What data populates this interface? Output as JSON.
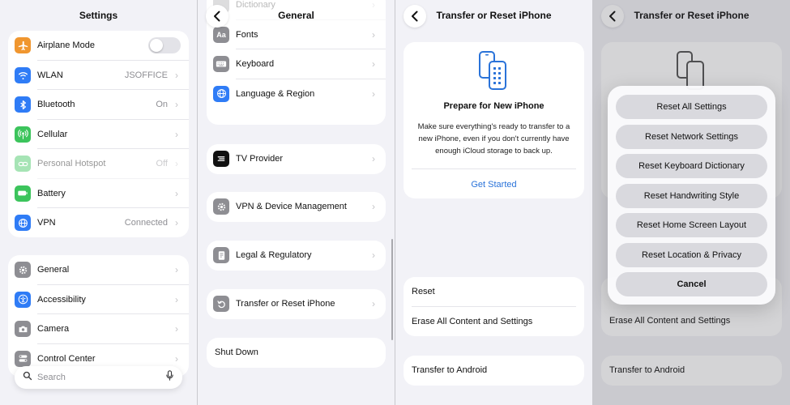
{
  "panel1": {
    "title": "Settings",
    "group1": [
      {
        "name": "airplane",
        "label": "Airplane Mode",
        "value": "",
        "icon": "airplane-icon",
        "color": "#f0962f"
      },
      {
        "name": "wlan",
        "label": "WLAN",
        "value": "JSOFFICE",
        "icon": "wifi-icon",
        "color": "#2f7cf6"
      },
      {
        "name": "bluetooth",
        "label": "Bluetooth",
        "value": "On",
        "icon": "bluetooth-icon",
        "color": "#2f7cf6"
      },
      {
        "name": "cellular",
        "label": "Cellular",
        "value": "",
        "icon": "antenna-icon",
        "color": "#3cc45c"
      },
      {
        "name": "hotspot",
        "label": "Personal Hotspot",
        "value": "Off",
        "icon": "link-icon",
        "color": "#3cc45c"
      },
      {
        "name": "battery",
        "label": "Battery",
        "value": "",
        "icon": "battery-icon",
        "color": "#3cc45c"
      },
      {
        "name": "vpn",
        "label": "VPN",
        "value": "Connected",
        "icon": "globe-icon",
        "color": "#2f7cf6"
      }
    ],
    "group2": [
      {
        "name": "general",
        "label": "General",
        "value": "",
        "icon": "gear-icon",
        "color": "#8e8e93"
      },
      {
        "name": "accessibility",
        "label": "Accessibility",
        "value": "",
        "icon": "accessibility-icon",
        "color": "#2f7cf6"
      },
      {
        "name": "camera",
        "label": "Camera",
        "value": "",
        "icon": "camera-icon",
        "color": "#8e8e93"
      },
      {
        "name": "control-center",
        "label": "Control Center",
        "value": "",
        "icon": "switches-icon",
        "color": "#8e8e93"
      }
    ],
    "search_placeholder": "Search"
  },
  "panel2": {
    "title": "General",
    "faded_item": "Dictionary",
    "group1": [
      {
        "name": "fonts",
        "label": "Fonts",
        "icon": "font-icon",
        "color": "#8e8e93"
      },
      {
        "name": "keyboard",
        "label": "Keyboard",
        "icon": "keyboard-icon",
        "color": "#8e8e93"
      },
      {
        "name": "language",
        "label": "Language & Region",
        "icon": "globe-icon",
        "color": "#2f7cf6"
      }
    ],
    "tv_provider": "TV Provider",
    "vpn_management": "VPN & Device Management",
    "legal": "Legal & Regulatory",
    "transfer_reset": "Transfer or Reset iPhone",
    "shut_down": "Shut Down"
  },
  "panel3": {
    "title": "Transfer or Reset iPhone",
    "prepare_title": "Prepare for New iPhone",
    "prepare_desc": "Make sure everything's ready to transfer to a new iPhone, even if you don't currently have enough iCloud storage to back up.",
    "get_started": "Get Started",
    "reset": "Reset",
    "erase_all": "Erase All Content and Settings",
    "transfer_android": "Transfer to Android"
  },
  "panel4": {
    "title": "Transfer or Reset iPhone",
    "erase_all": "Erase All Content and Settings",
    "transfer_android": "Transfer to Android",
    "sheet_buttons": [
      "Reset All Settings",
      "Reset Network Settings",
      "Reset Keyboard Dictionary",
      "Reset Handwriting Style",
      "Reset Home Screen Layout",
      "Reset Location & Privacy"
    ],
    "cancel": "Cancel"
  },
  "colors": {
    "accent": "#2a73d9",
    "background": "#f2f2f7",
    "card": "#ffffff"
  }
}
